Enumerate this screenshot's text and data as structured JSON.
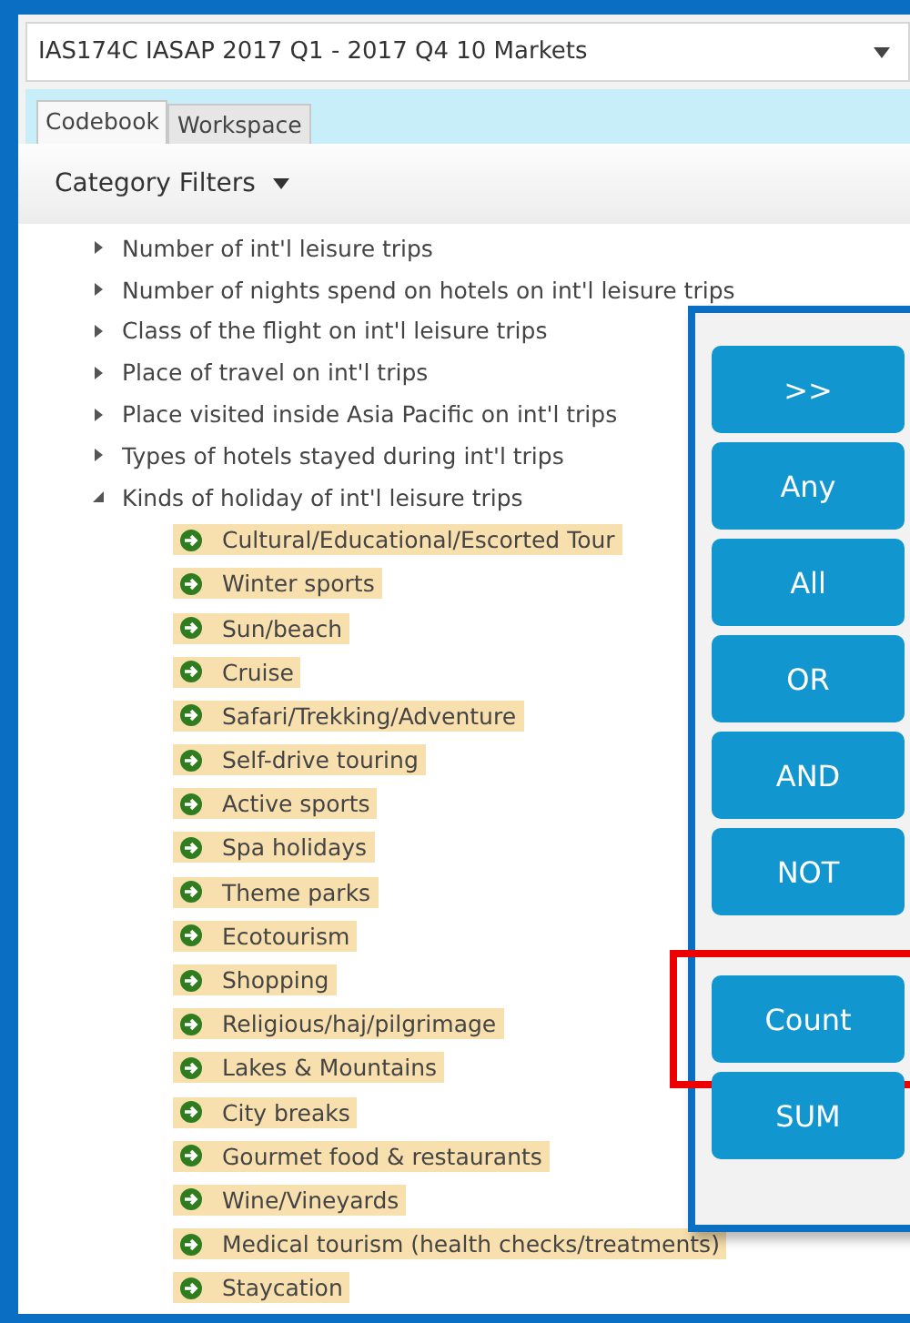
{
  "dataset_select": {
    "value": "IAS174C IASAP 2017 Q1 - 2017 Q4 10 Markets"
  },
  "tabs": [
    {
      "label": "Codebook",
      "selected": true
    },
    {
      "label": "Workspace",
      "selected": false
    }
  ],
  "filter_menu": {
    "label": "Category Filters"
  },
  "tree": [
    {
      "label": "Number of int'l leisure trips",
      "expanded": false
    },
    {
      "label": "Number of nights spend on hotels on int'l leisure trips",
      "expanded": false
    },
    {
      "label": "Class of the flight on int'l leisure trips",
      "expanded": false
    },
    {
      "label": "Place of travel on int'l trips",
      "expanded": false
    },
    {
      "label": "Place visited inside Asia Pacific on int'l trips",
      "expanded": false
    },
    {
      "label": "Types of hotels stayed during int'l trips",
      "expanded": false
    },
    {
      "label": "Kinds of holiday of int'l leisure trips",
      "expanded": true,
      "children": [
        {
          "label": "Cultural/Educational/Escorted Tour",
          "highlighted": true
        },
        {
          "label": "Winter sports",
          "highlighted": true
        },
        {
          "label": "Sun/beach",
          "highlighted": true
        },
        {
          "label": "Cruise",
          "highlighted": true
        },
        {
          "label": "Safari/Trekking/Adventure",
          "highlighted": true
        },
        {
          "label": "Self-drive touring",
          "highlighted": true
        },
        {
          "label": "Active sports",
          "highlighted": true
        },
        {
          "label": "Spa holidays",
          "highlighted": true
        },
        {
          "label": "Theme parks",
          "highlighted": true
        },
        {
          "label": "Ecotourism",
          "highlighted": true
        },
        {
          "label": "Shopping",
          "highlighted": true
        },
        {
          "label": "Religious/haj/pilgrimage",
          "highlighted": true
        },
        {
          "label": "Lakes & Mountains",
          "highlighted": true
        },
        {
          "label": "City breaks",
          "highlighted": true
        },
        {
          "label": "Gourmet food & restaurants",
          "highlighted": true
        },
        {
          "label": "Wine/Vineyards",
          "highlighted": true
        },
        {
          "label": "Medical tourism (health checks/treatments)",
          "highlighted": true
        },
        {
          "label": "Staycation",
          "highlighted": true
        }
      ]
    }
  ],
  "operator_panel": {
    "button_groups": [
      [
        {
          "label": ">>",
          "highlighted": false
        },
        {
          "label": "Any",
          "highlighted": false
        },
        {
          "label": "All",
          "highlighted": false
        },
        {
          "label": "OR",
          "highlighted": false
        },
        {
          "label": "AND",
          "highlighted": false
        },
        {
          "label": "NOT",
          "highlighted": false
        }
      ],
      [
        {
          "label": "Count",
          "highlighted": true
        },
        {
          "label": "SUM",
          "highlighted": false
        }
      ]
    ]
  }
}
